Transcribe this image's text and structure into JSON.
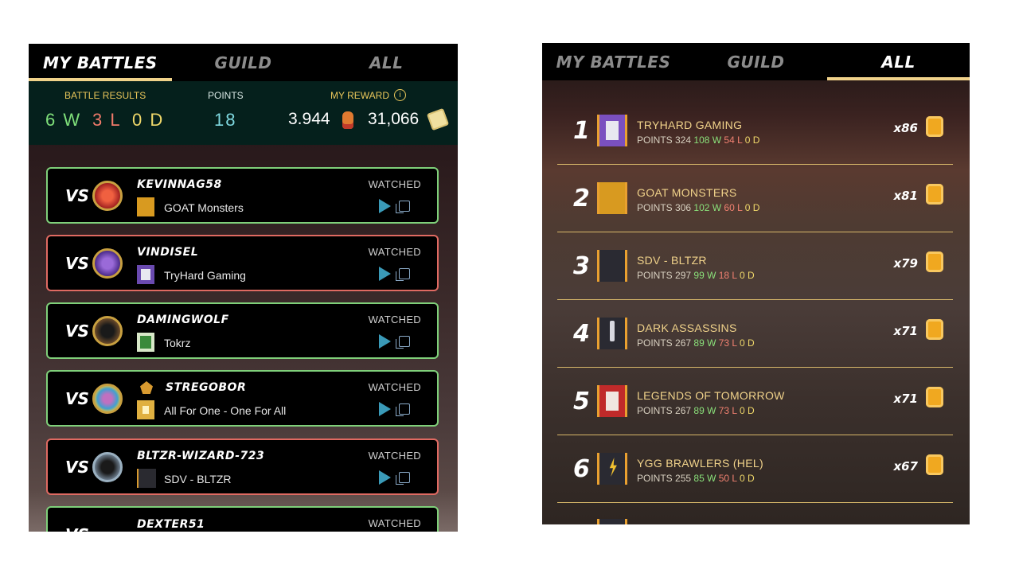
{
  "left": {
    "tabs": [
      {
        "label": "MY BATTLES",
        "active": true
      },
      {
        "label": "GUILD",
        "active": false
      },
      {
        "label": "ALL",
        "active": false
      }
    ],
    "summary": {
      "battle_results_label": "BATTLE RESULTS",
      "wins": "6 W",
      "losses": "3 L",
      "draws": "0 D",
      "points_label": "POINTS",
      "points": "18",
      "reward_label": "MY REWARD",
      "reward_1": "3.944",
      "reward_2": "31,066"
    },
    "battles": [
      {
        "vs": "VS",
        "player": "KEVINNAG58",
        "guild": "GOAT Monsters",
        "status": "WATCHED",
        "result": "win"
      },
      {
        "vs": "VS",
        "player": "VINDISEL",
        "guild": "TryHard Gaming",
        "status": "WATCHED",
        "result": "lose"
      },
      {
        "vs": "VS",
        "player": "DAMINGWOLF",
        "guild": "Tokrz",
        "status": "WATCHED",
        "result": "win"
      },
      {
        "vs": "VS",
        "player": "STREGOBOR",
        "guild": "All For One - One For All",
        "status": "WATCHED",
        "result": "win"
      },
      {
        "vs": "VS",
        "player": "BLTZR-WIZARD-723",
        "guild": "SDV - BLTZR",
        "status": "WATCHED",
        "result": "lose"
      },
      {
        "vs": "VS",
        "player": "DEXTER51",
        "guild": "",
        "status": "WATCHED",
        "result": "win"
      }
    ],
    "colors": {
      "win_border": "#7fd07a",
      "lose_border": "#e06a62",
      "accent": "#f0d28a"
    }
  },
  "right": {
    "tabs": [
      {
        "label": "MY BATTLES",
        "active": false
      },
      {
        "label": "GUILD",
        "active": false
      },
      {
        "label": "ALL",
        "active": true
      }
    ],
    "guilds": [
      {
        "rank": "1",
        "name": "TRYHARD GAMING",
        "points_label": "POINTS",
        "points": "324",
        "w": "108 W",
        "l": "54 L",
        "d": "0 D",
        "mult": "x86"
      },
      {
        "rank": "2",
        "name": "GOAT MONSTERS",
        "points_label": "POINTS",
        "points": "306",
        "w": "102 W",
        "l": "60 L",
        "d": "0 D",
        "mult": "x81"
      },
      {
        "rank": "3",
        "name": "SDV - BLTZR",
        "points_label": "POINTS",
        "points": "297",
        "w": "99 W",
        "l": "18 L",
        "d": "0 D",
        "mult": "x79"
      },
      {
        "rank": "4",
        "name": "DARK ASSASSINS",
        "points_label": "POINTS",
        "points": "267",
        "w": "89 W",
        "l": "73 L",
        "d": "0 D",
        "mult": "x71"
      },
      {
        "rank": "5",
        "name": "LEGENDS OF TOMORROW",
        "points_label": "POINTS",
        "points": "267",
        "w": "89 W",
        "l": "73 L",
        "d": "0 D",
        "mult": "x71"
      },
      {
        "rank": "6",
        "name": "YGG BRAWLERS (HEL)",
        "points_label": "POINTS",
        "points": "255",
        "w": "85 W",
        "l": "50 L",
        "d": "0 D",
        "mult": "x67"
      }
    ]
  }
}
